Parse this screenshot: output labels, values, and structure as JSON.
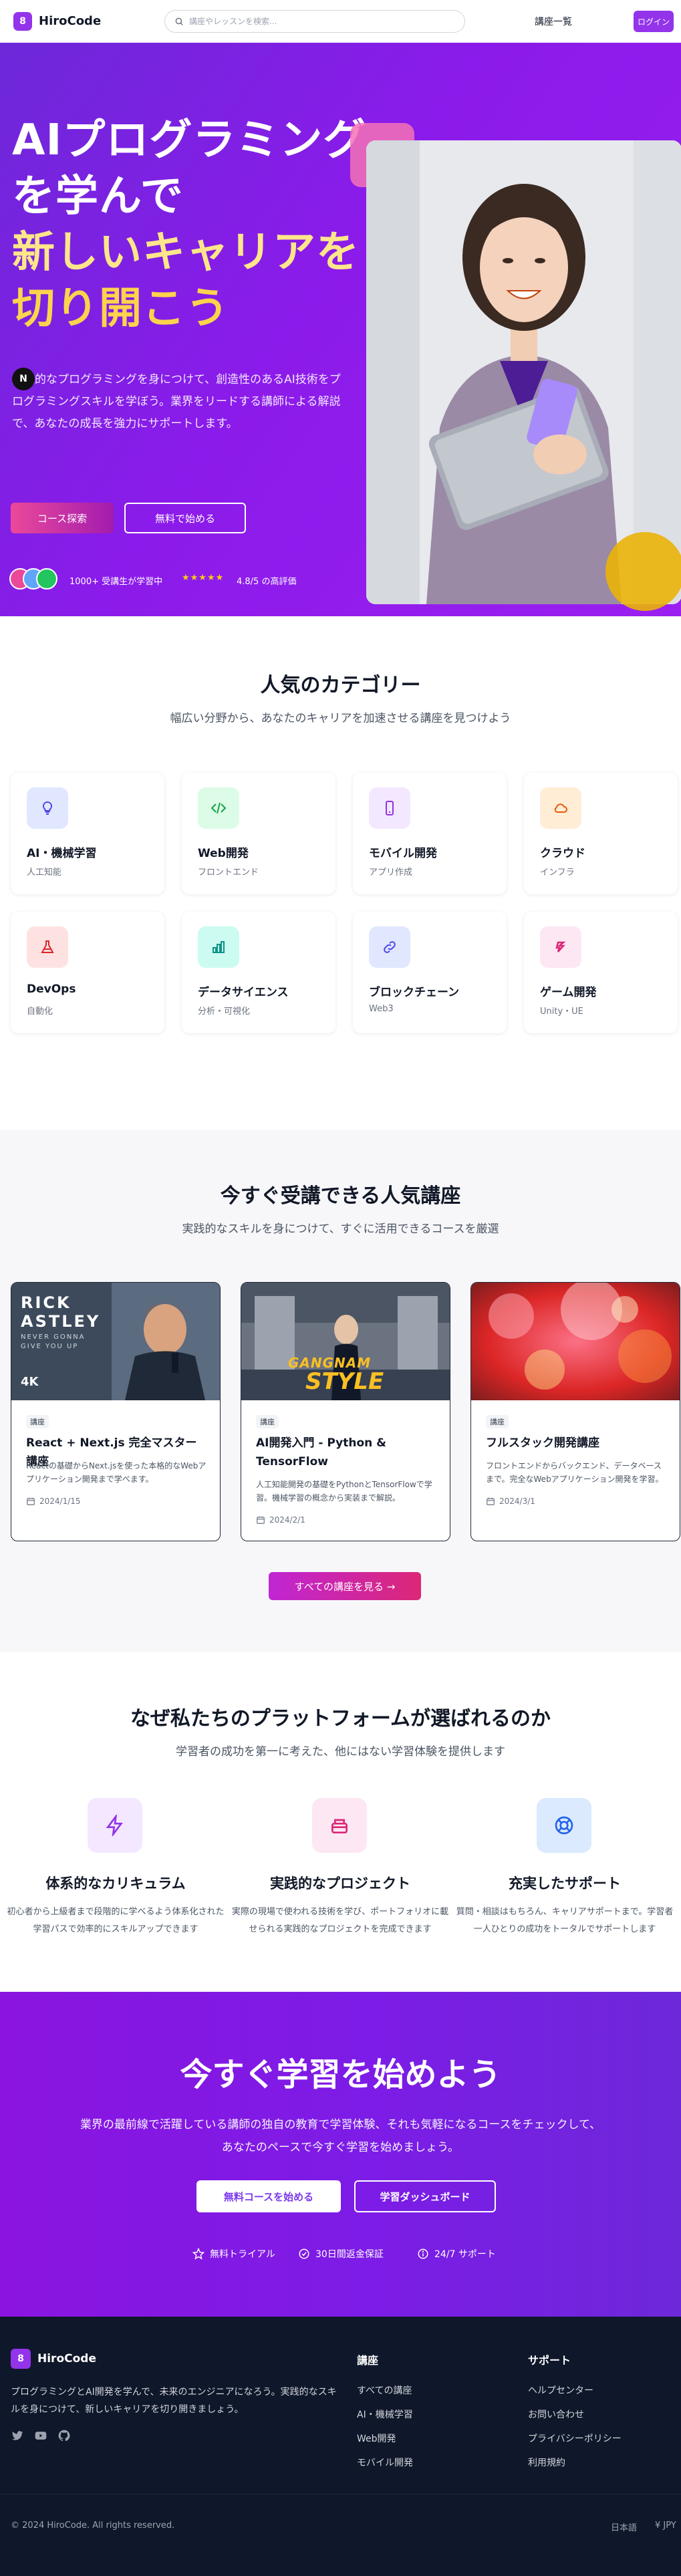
{
  "header": {
    "logo_letter": "8",
    "brand": "HiroCode",
    "search_placeholder": "講座やレッスンを検索...",
    "nav_courses": "講座一覧",
    "login": "ログイン"
  },
  "hero": {
    "title_line1": "AIプログラミング",
    "title_line2": "を学んで",
    "title_line3": "新しいキャリアを",
    "title_line4": "切り開こう",
    "badge_letter": "N",
    "description": "実践的なプログラミングを身につけて、創造性のあるAI技術をプログラミングスキルを学ぼう。業界をリードする講師による解説で、あなたの成長を強力にサポートします。",
    "primary_button": "コース探索",
    "secondary_button": "無料で始める",
    "students_text": "1000+ 受講生が学習中",
    "stars": "★★★★★",
    "rating_text": "4.8/5 の高評価"
  },
  "categories": {
    "title": "人気のカテゴリー",
    "subtitle": "幅広い分野から、あなたのキャリアを加速させる講座を見つけよう",
    "items": [
      {
        "name": "AI・機械学習",
        "desc": "人工知能",
        "icon": "lightbulb-icon",
        "bg": "#e0e7ff",
        "fg": "#4f46e5"
      },
      {
        "name": "Web開発",
        "desc": "フロントエンド",
        "icon": "code-icon",
        "bg": "#dcfce7",
        "fg": "#16a34a"
      },
      {
        "name": "モバイル開発",
        "desc": "アプリ作成",
        "icon": "mobile-icon",
        "bg": "#f3e8ff",
        "fg": "#9333ea"
      },
      {
        "name": "クラウド",
        "desc": "インフラ",
        "icon": "cloud-icon",
        "bg": "#ffedd5",
        "fg": "#ea580c"
      },
      {
        "name": "DevOps",
        "desc": "自動化",
        "icon": "flask-icon",
        "bg": "#fee2e2",
        "fg": "#dc2626"
      },
      {
        "name": "データサイエンス",
        "desc": "分析・可視化",
        "icon": "chart-icon",
        "bg": "#ccfbf1",
        "fg": "#0d9488"
      },
      {
        "name": "ブロックチェーン",
        "desc": "Web3",
        "icon": "link-icon",
        "bg": "#e0e7ff",
        "fg": "#4f46e5"
      },
      {
        "name": "ゲーム開発",
        "desc": "Unity・UE",
        "icon": "game-icon",
        "bg": "#fce7f3",
        "fg": "#db2777"
      }
    ]
  },
  "courses": {
    "title": "今すぐ受講できる人気講座",
    "subtitle": "実践的なスキルを身につけて、すぐに活用できるコースを厳選",
    "thumb1_line1": "RICK",
    "thumb1_line2": "ASTLEY",
    "thumb1_line3": "NEVER GONNA",
    "thumb1_line4": "GIVE YOU UP",
    "thumb1_badge": "4K",
    "thumb2_line1": "GANGNAM",
    "thumb2_line2": "STYLE",
    "items": [
      {
        "tag": "講座",
        "title": "React + Next.js 完全マスター講座",
        "desc": "Reactの基礎からNext.jsを使った本格的なWebアプリケーション開発まで学べます。",
        "date": "2024/1/15"
      },
      {
        "tag": "講座",
        "title": "AI開発入門 - Python & TensorFlow",
        "desc": "人工知能開発の基礎をPythonとTensorFlowで学習。機械学習の概念から実装まで解説。",
        "date": "2024/2/1"
      },
      {
        "tag": "講座",
        "title": "フルスタック開発講座",
        "desc": "フロントエンドからバックエンド、データベースまで。完全なWebアプリケーション開発を学習。",
        "date": "2024/3/1"
      }
    ],
    "all_button": "すべての講座を見る →"
  },
  "why": {
    "title": "なぜ私たちのプラットフォームが選ばれるのか",
    "subtitle": "学習者の成功を第一に考えた、他にはない学習体験を提供します",
    "items": [
      {
        "title": "体系的なカリキュラム",
        "desc": "初心者から上級者まで段階的に学べるよう体系化された学習パスで効率的にスキルアップできます",
        "icon": "bolt-icon",
        "bg": "#f3e8ff",
        "fg": "#9333ea"
      },
      {
        "title": "実践的なプロジェクト",
        "desc": "実際の現場で使われる技術を学び、ポートフォリオに載せられる実践的なプロジェクトを完成できます",
        "icon": "box-icon",
        "bg": "#fce7f3",
        "fg": "#db2777"
      },
      {
        "title": "充実したサポート",
        "desc": "質問・相談はもちろん、キャリアサポートまで。学習者一人ひとりの成功をトータルでサポートします",
        "icon": "lifebuoy-icon",
        "bg": "#dbeafe",
        "fg": "#2563eb"
      }
    ]
  },
  "cta": {
    "title": "今すぐ学習を始めよう",
    "description": "業界の最前線で活躍している講師の独自の教育で学習体験、それも気軽になるコースをチェックして、あなたのペースで今すぐ学習を始めましょう。",
    "button_primary": "無料コースを始める",
    "button_secondary": "学習ダッシュボード",
    "feature1": "無料トライアル",
    "feature2": "30日間返金保証",
    "feature3": "24/7 サポート"
  },
  "footer": {
    "logo_letter": "8",
    "brand": "HiroCode",
    "description": "プログラミングとAI開発を学んで、未来のエンジニアになろう。実践的なスキルを身につけて、新しいキャリアを切り開きましょう。",
    "col1_title": "講座",
    "col1_links": [
      "すべての講座",
      "AI・機械学習",
      "Web開発",
      "モバイル開発"
    ],
    "col2_title": "サポート",
    "col2_links": [
      "ヘルプセンター",
      "お問い合わせ",
      "プライバシーポリシー",
      "利用規約"
    ],
    "copyright": "© 2024 HiroCode. All rights reserved.",
    "language": "日本語",
    "currency": "¥ JPY"
  }
}
